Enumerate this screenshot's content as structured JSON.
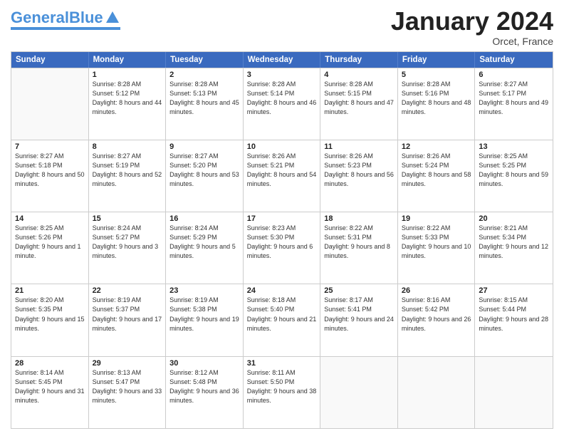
{
  "logo": {
    "line1": "General",
    "line2": "Blue"
  },
  "title": {
    "month_year": "January 2024",
    "location": "Orcet, France"
  },
  "calendar": {
    "headers": [
      "Sunday",
      "Monday",
      "Tuesday",
      "Wednesday",
      "Thursday",
      "Friday",
      "Saturday"
    ],
    "weeks": [
      [
        {
          "day": "",
          "sunrise": "",
          "sunset": "",
          "daylight": ""
        },
        {
          "day": "1",
          "sunrise": "Sunrise: 8:28 AM",
          "sunset": "Sunset: 5:12 PM",
          "daylight": "Daylight: 8 hours and 44 minutes."
        },
        {
          "day": "2",
          "sunrise": "Sunrise: 8:28 AM",
          "sunset": "Sunset: 5:13 PM",
          "daylight": "Daylight: 8 hours and 45 minutes."
        },
        {
          "day": "3",
          "sunrise": "Sunrise: 8:28 AM",
          "sunset": "Sunset: 5:14 PM",
          "daylight": "Daylight: 8 hours and 46 minutes."
        },
        {
          "day": "4",
          "sunrise": "Sunrise: 8:28 AM",
          "sunset": "Sunset: 5:15 PM",
          "daylight": "Daylight: 8 hours and 47 minutes."
        },
        {
          "day": "5",
          "sunrise": "Sunrise: 8:28 AM",
          "sunset": "Sunset: 5:16 PM",
          "daylight": "Daylight: 8 hours and 48 minutes."
        },
        {
          "day": "6",
          "sunrise": "Sunrise: 8:27 AM",
          "sunset": "Sunset: 5:17 PM",
          "daylight": "Daylight: 8 hours and 49 minutes."
        }
      ],
      [
        {
          "day": "7",
          "sunrise": "Sunrise: 8:27 AM",
          "sunset": "Sunset: 5:18 PM",
          "daylight": "Daylight: 8 hours and 50 minutes."
        },
        {
          "day": "8",
          "sunrise": "Sunrise: 8:27 AM",
          "sunset": "Sunset: 5:19 PM",
          "daylight": "Daylight: 8 hours and 52 minutes."
        },
        {
          "day": "9",
          "sunrise": "Sunrise: 8:27 AM",
          "sunset": "Sunset: 5:20 PM",
          "daylight": "Daylight: 8 hours and 53 minutes."
        },
        {
          "day": "10",
          "sunrise": "Sunrise: 8:26 AM",
          "sunset": "Sunset: 5:21 PM",
          "daylight": "Daylight: 8 hours and 54 minutes."
        },
        {
          "day": "11",
          "sunrise": "Sunrise: 8:26 AM",
          "sunset": "Sunset: 5:23 PM",
          "daylight": "Daylight: 8 hours and 56 minutes."
        },
        {
          "day": "12",
          "sunrise": "Sunrise: 8:26 AM",
          "sunset": "Sunset: 5:24 PM",
          "daylight": "Daylight: 8 hours and 58 minutes."
        },
        {
          "day": "13",
          "sunrise": "Sunrise: 8:25 AM",
          "sunset": "Sunset: 5:25 PM",
          "daylight": "Daylight: 8 hours and 59 minutes."
        }
      ],
      [
        {
          "day": "14",
          "sunrise": "Sunrise: 8:25 AM",
          "sunset": "Sunset: 5:26 PM",
          "daylight": "Daylight: 9 hours and 1 minute."
        },
        {
          "day": "15",
          "sunrise": "Sunrise: 8:24 AM",
          "sunset": "Sunset: 5:27 PM",
          "daylight": "Daylight: 9 hours and 3 minutes."
        },
        {
          "day": "16",
          "sunrise": "Sunrise: 8:24 AM",
          "sunset": "Sunset: 5:29 PM",
          "daylight": "Daylight: 9 hours and 5 minutes."
        },
        {
          "day": "17",
          "sunrise": "Sunrise: 8:23 AM",
          "sunset": "Sunset: 5:30 PM",
          "daylight": "Daylight: 9 hours and 6 minutes."
        },
        {
          "day": "18",
          "sunrise": "Sunrise: 8:22 AM",
          "sunset": "Sunset: 5:31 PM",
          "daylight": "Daylight: 9 hours and 8 minutes."
        },
        {
          "day": "19",
          "sunrise": "Sunrise: 8:22 AM",
          "sunset": "Sunset: 5:33 PM",
          "daylight": "Daylight: 9 hours and 10 minutes."
        },
        {
          "day": "20",
          "sunrise": "Sunrise: 8:21 AM",
          "sunset": "Sunset: 5:34 PM",
          "daylight": "Daylight: 9 hours and 12 minutes."
        }
      ],
      [
        {
          "day": "21",
          "sunrise": "Sunrise: 8:20 AM",
          "sunset": "Sunset: 5:35 PM",
          "daylight": "Daylight: 9 hours and 15 minutes."
        },
        {
          "day": "22",
          "sunrise": "Sunrise: 8:19 AM",
          "sunset": "Sunset: 5:37 PM",
          "daylight": "Daylight: 9 hours and 17 minutes."
        },
        {
          "day": "23",
          "sunrise": "Sunrise: 8:19 AM",
          "sunset": "Sunset: 5:38 PM",
          "daylight": "Daylight: 9 hours and 19 minutes."
        },
        {
          "day": "24",
          "sunrise": "Sunrise: 8:18 AM",
          "sunset": "Sunset: 5:40 PM",
          "daylight": "Daylight: 9 hours and 21 minutes."
        },
        {
          "day": "25",
          "sunrise": "Sunrise: 8:17 AM",
          "sunset": "Sunset: 5:41 PM",
          "daylight": "Daylight: 9 hours and 24 minutes."
        },
        {
          "day": "26",
          "sunrise": "Sunrise: 8:16 AM",
          "sunset": "Sunset: 5:42 PM",
          "daylight": "Daylight: 9 hours and 26 minutes."
        },
        {
          "day": "27",
          "sunrise": "Sunrise: 8:15 AM",
          "sunset": "Sunset: 5:44 PM",
          "daylight": "Daylight: 9 hours and 28 minutes."
        }
      ],
      [
        {
          "day": "28",
          "sunrise": "Sunrise: 8:14 AM",
          "sunset": "Sunset: 5:45 PM",
          "daylight": "Daylight: 9 hours and 31 minutes."
        },
        {
          "day": "29",
          "sunrise": "Sunrise: 8:13 AM",
          "sunset": "Sunset: 5:47 PM",
          "daylight": "Daylight: 9 hours and 33 minutes."
        },
        {
          "day": "30",
          "sunrise": "Sunrise: 8:12 AM",
          "sunset": "Sunset: 5:48 PM",
          "daylight": "Daylight: 9 hours and 36 minutes."
        },
        {
          "day": "31",
          "sunrise": "Sunrise: 8:11 AM",
          "sunset": "Sunset: 5:50 PM",
          "daylight": "Daylight: 9 hours and 38 minutes."
        },
        {
          "day": "",
          "sunrise": "",
          "sunset": "",
          "daylight": ""
        },
        {
          "day": "",
          "sunrise": "",
          "sunset": "",
          "daylight": ""
        },
        {
          "day": "",
          "sunrise": "",
          "sunset": "",
          "daylight": ""
        }
      ]
    ]
  }
}
